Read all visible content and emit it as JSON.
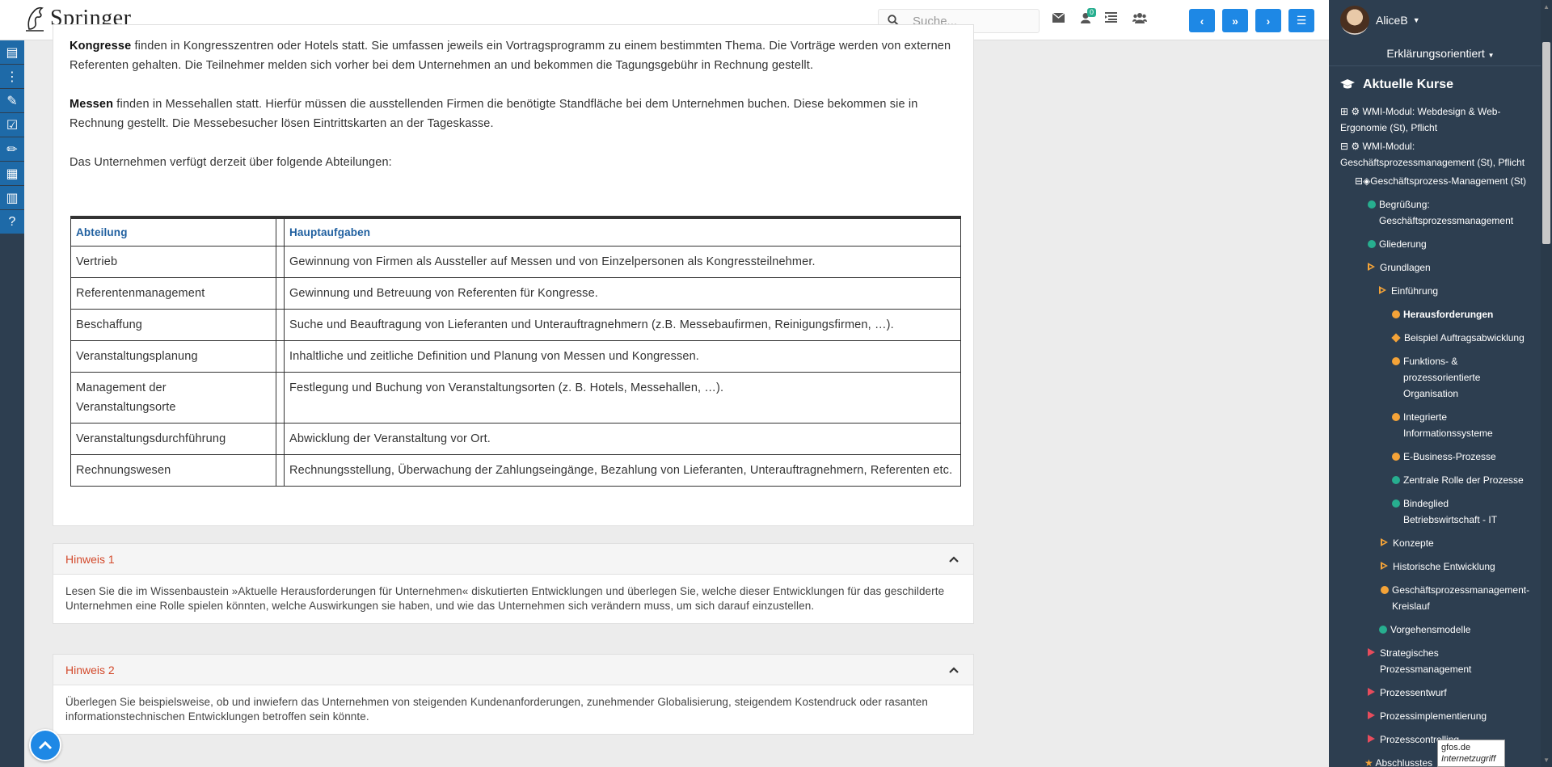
{
  "app": {
    "brand": "Springer"
  },
  "header": {
    "search_placeholder": "Suche...",
    "notification_count": "0",
    "nav_prev": "‹",
    "nav_down": "»",
    "nav_next": "›",
    "menu": "☰"
  },
  "user": {
    "name": "AliceB",
    "mode": "Erklärungsorientiert"
  },
  "sidebar": {
    "heading": "Aktuelle Kurse",
    "items": [
      {
        "label": "WMI-Modul: Webdesign & Web-",
        "label2": "Ergonomie (St), Pflicht"
      },
      {
        "label": "WMI-Modul:",
        "label2": "Geschäftsprozessmanagement (St), Pflicht"
      },
      {
        "label": "Geschäftsprozess-Management (St)"
      },
      {
        "label": "Begrüßung:",
        "label2": "Geschäftsprozessmanagement"
      },
      {
        "label": "Gliederung"
      },
      {
        "label": "Grundlagen"
      },
      {
        "label": "Einführung"
      },
      {
        "label": "Herausforderungen"
      },
      {
        "label": "Beispiel Auftragsabwicklung"
      },
      {
        "label": "Funktions- &",
        "label2": "prozessorientierte",
        "label3": "Organisation"
      },
      {
        "label": "Integrierte",
        "label2": "Informationssysteme"
      },
      {
        "label": "E-Business-Prozesse"
      },
      {
        "label": "Zentrale Rolle der Prozesse"
      },
      {
        "label": "Bindeglied",
        "label2": "Betriebswirtschaft - IT"
      },
      {
        "label": "Konzepte"
      },
      {
        "label": "Historische Entwicklung"
      },
      {
        "label": "Geschäftsprozessmanagement-",
        "label2": "Kreislauf"
      },
      {
        "label": "Vorgehensmodelle"
      },
      {
        "label": "Strategisches",
        "label2": "Prozessmanagement"
      },
      {
        "label": "Prozessentwurf"
      },
      {
        "label": "Prozessimplementierung"
      },
      {
        "label": "Prozesscontrolling"
      },
      {
        "label": "Abschlusstes"
      }
    ]
  },
  "tooltip": {
    "line1": "gfos.de",
    "line2": "Internetzugriff"
  },
  "content": {
    "p1_bold": "Kongresse",
    "p1_rest": " finden in Kongresszentren oder Hotels statt. Sie umfassen jeweils ein Vortragsprogramm zu einem bestimmten Thema. Die Vorträge werden von externen Referenten gehalten. Die Teilnehmer melden sich vorher bei dem Unternehmen an und bekommen die Tagungsgebühr in Rechnung gestellt.",
    "p2_bold": "Messen",
    "p2_rest": " finden in Messehallen statt. Hierfür müssen die ausstellenden Firmen die benötigte Standfläche bei dem Unternehmen buchen. Diese bekommen sie in Rechnung gestellt. Die Messebesucher lösen Eintrittskarten an der Tageskasse.",
    "p3": "Das Unternehmen verfügt derzeit über folgende Abteilungen:",
    "table": {
      "headers": [
        "Abteilung",
        "Hauptaufgaben"
      ],
      "rows": [
        [
          "Vertrieb",
          "Gewinnung von Firmen als Aussteller auf Messen und von Einzelpersonen als Kongressteilnehmer."
        ],
        [
          "Referentenmanagement",
          "Gewinnung und Betreuung von Referenten für Kongresse."
        ],
        [
          "Beschaffung",
          "Suche und Beauftragung von Lieferanten und Unterauftragnehmern (z.B. Messebaufirmen, Reinigungsfirmen, …)."
        ],
        [
          "Veranstaltungsplanung",
          "Inhaltliche und zeitliche Definition und Planung von Messen und Kongressen."
        ],
        [
          "Management der Veranstaltungsorte",
          "Festlegung und Buchung von Veranstaltungsorten (z. B. Hotels, Messehallen, …)."
        ],
        [
          "Veranstaltungsdurchführung",
          "Abwicklung der Veranstaltung vor Ort."
        ],
        [
          "Rechnungswesen",
          "Rechnungsstellung, Überwachung der Zahlungseingänge, Bezahlung von Lieferanten, Unterauftragnehmern, Referenten etc."
        ]
      ]
    },
    "hints": [
      {
        "title": "Hinweis 1",
        "body": "Lesen Sie die im Wissenbaustein »Aktuelle Herausforderungen für Unternehmen« diskutierten Entwicklungen und überlegen Sie, welche dieser Entwicklungen für das geschilderte Unternehmen eine Rolle spielen könnten, welche Auswirkungen sie haben, und wie das Unternehmen sich verändern muss, um sich darauf einzustellen."
      },
      {
        "title": "Hinweis 2",
        "body": "Überlegen Sie beispielsweise, ob und inwiefern das Unternehmen von steigenden Kundenanforderungen, zunehmender Globalisierung, steigendem Kostendruck oder rasanten informationstechnischen Entwicklungen betroffen sein könnte."
      }
    ]
  },
  "colors": {
    "accent": "#1e88e5",
    "sidebar_bg": "#2d3e50",
    "hint_title": "#d34a2c",
    "status_green": "#27ae8f",
    "status_orange": "#f4a338",
    "status_red": "#e74c5c"
  }
}
